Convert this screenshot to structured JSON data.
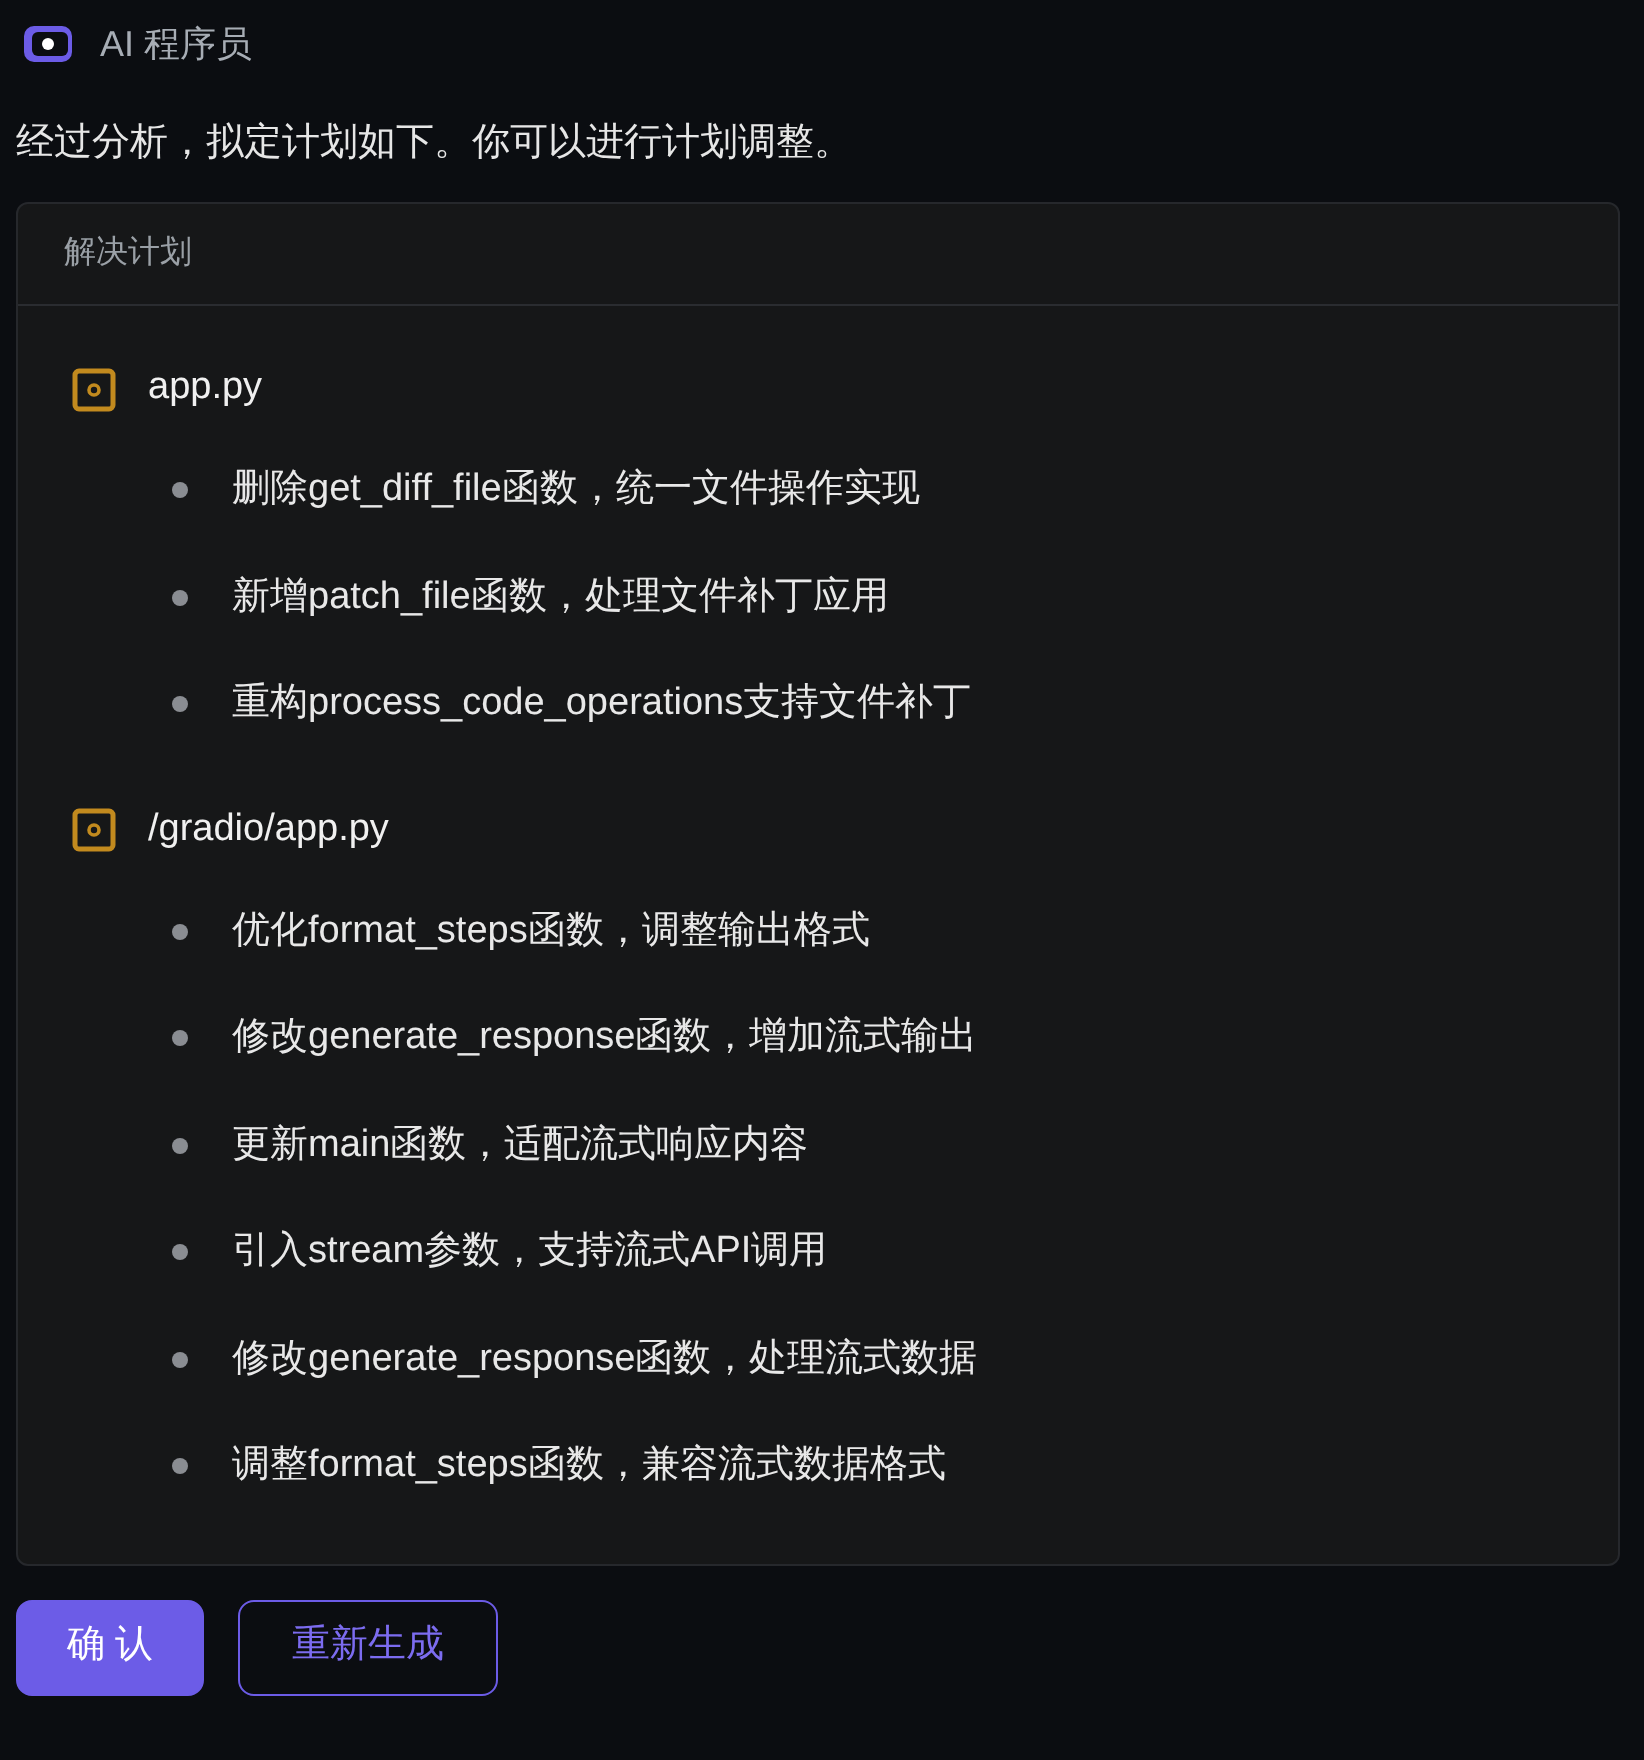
{
  "header": {
    "title": "AI 程序员"
  },
  "intro": "经过分析，拟定计划如下。你可以进行计划调整。",
  "plan": {
    "title": "解决计划",
    "files": [
      {
        "name": "app.py",
        "steps": [
          "删除get_diff_file函数，统一文件操作实现",
          "新增patch_file函数，处理文件补丁应用",
          "重构process_code_operations支持文件补丁"
        ]
      },
      {
        "name": "/gradio/app.py",
        "steps": [
          "优化format_steps函数，调整输出格式",
          "修改generate_response函数，增加流式输出",
          "更新main函数，适配流式响应内容",
          "引入stream参数，支持流式API调用",
          "修改generate_response函数，处理流式数据",
          "调整format_steps函数，兼容流式数据格式"
        ]
      }
    ]
  },
  "buttons": [
    {
      "label": "确 认",
      "kind": "primary"
    },
    {
      "label": "重新生成",
      "kind": "outline"
    }
  ]
}
